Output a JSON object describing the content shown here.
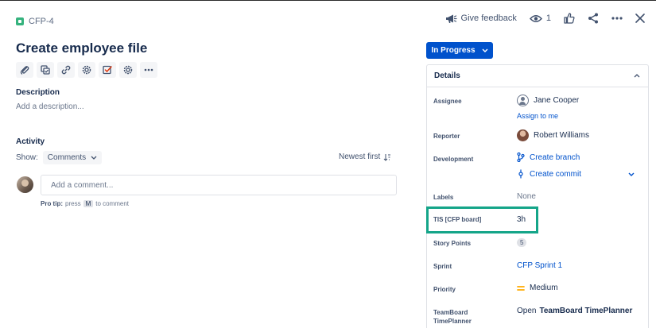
{
  "issue": {
    "key": "CFP-4",
    "title": "Create employee file"
  },
  "top_actions": {
    "feedback_label": "Give feedback",
    "watch_count": "1"
  },
  "description": {
    "label": "Description",
    "placeholder": "Add a description..."
  },
  "activity": {
    "label": "Activity",
    "show_label": "Show:",
    "filter_value": "Comments",
    "sort_label": "Newest first",
    "comment_placeholder": "Add a comment...",
    "protip_prefix": "Pro tip:",
    "protip_press": "press",
    "protip_key": "M",
    "protip_suffix": "to comment"
  },
  "status": {
    "label": "In Progress"
  },
  "details": {
    "header": "Details",
    "assignee_label": "Assignee",
    "assignee_value": "Jane Cooper",
    "assign_to_me": "Assign to me",
    "reporter_label": "Reporter",
    "reporter_value": "Robert Williams",
    "development_label": "Development",
    "create_branch": "Create branch",
    "create_commit": "Create commit",
    "labels_label": "Labels",
    "labels_value": "None",
    "tis_label": "TIS [CFP board]",
    "tis_value": "3h",
    "story_points_label": "Story Points",
    "story_points_value": "5",
    "sprint_label": "Sprint",
    "sprint_value": "CFP Sprint 1",
    "priority_label": "Priority",
    "priority_value": "Medium",
    "teamboard_label_1": "TeamBoard",
    "teamboard_label_2": "TimePlanner",
    "teamboard_open": "Open",
    "teamboard_value": "TeamBoard TimePlanner"
  },
  "colors": {
    "primary": "#0052cc",
    "highlight": "#15a589",
    "story": "#36b37e",
    "priority_medium": "#ffab00"
  }
}
